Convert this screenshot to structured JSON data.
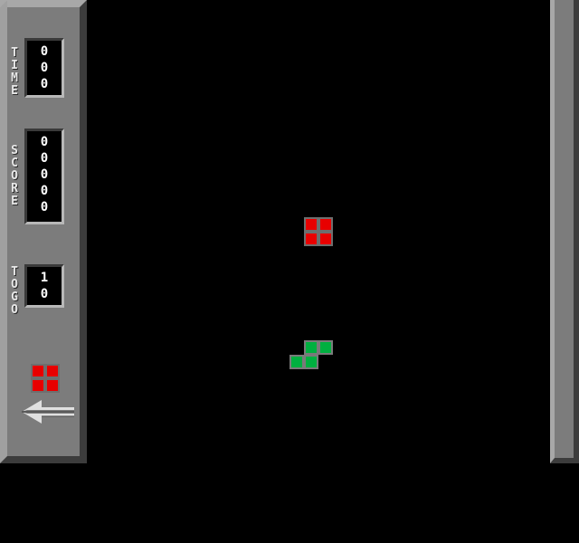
{
  "hud": {
    "time_label": [
      "T",
      "I",
      "M",
      "E"
    ],
    "time_digits": [
      "0",
      "0",
      "0"
    ],
    "score_label": [
      "S",
      "C",
      "O",
      "R",
      "E"
    ],
    "score_digits": [
      "0",
      "0",
      "0",
      "0",
      "0"
    ],
    "togo_label": [
      "T",
      "O",
      "G",
      "O"
    ],
    "togo_digits": [
      "1",
      "0"
    ]
  },
  "next_piece": {
    "shape": "O",
    "color": "#e80000"
  },
  "playfield": {
    "falling_piece": {
      "shape": "O",
      "color": "#e80000"
    },
    "settled_piece": {
      "shape": "S",
      "color": "#00b040"
    }
  },
  "colors": {
    "panel": "#7c7c7c",
    "background": "#000000"
  },
  "icons": {
    "back": "left-arrow-icon"
  }
}
